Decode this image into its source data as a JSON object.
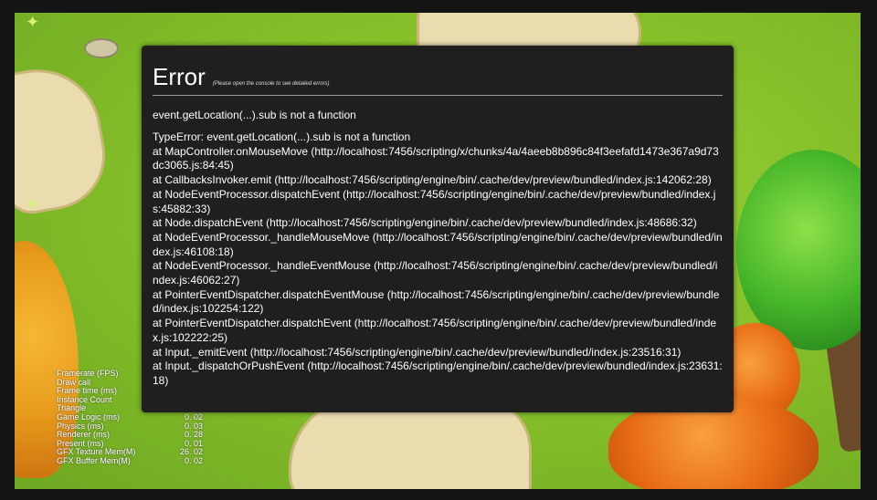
{
  "error": {
    "title": "Error",
    "hint": "(Please open the console to see detailed errors)",
    "message": "event.getLocation(...).sub is not a function",
    "stack": [
      "TypeError: event.getLocation(...).sub is not a function",
      "at MapController.onMouseMove (http://localhost:7456/scripting/x/chunks/4a/4aeeb8b896c84f3eefafd1473e367a9d73dc3065.js:84:45)",
      "at CallbacksInvoker.emit (http://localhost:7456/scripting/engine/bin/.cache/dev/preview/bundled/index.js:142062:28)",
      "at NodeEventProcessor.dispatchEvent (http://localhost:7456/scripting/engine/bin/.cache/dev/preview/bundled/index.js:45882:33)",
      "at Node.dispatchEvent (http://localhost:7456/scripting/engine/bin/.cache/dev/preview/bundled/index.js:48686:32)",
      "at NodeEventProcessor._handleMouseMove (http://localhost:7456/scripting/engine/bin/.cache/dev/preview/bundled/index.js:46108:18)",
      "at NodeEventProcessor._handleEventMouse (http://localhost:7456/scripting/engine/bin/.cache/dev/preview/bundled/index.js:46062:27)",
      "at PointerEventDispatcher.dispatchEventMouse (http://localhost:7456/scripting/engine/bin/.cache/dev/preview/bundled/index.js:102254:122)",
      "at PointerEventDispatcher.dispatchEvent (http://localhost:7456/scripting/engine/bin/.cache/dev/preview/bundled/index.js:102222:25)",
      "at Input._emitEvent (http://localhost:7456/scripting/engine/bin/.cache/dev/preview/bundled/index.js:23516:31)",
      "at Input._dispatchOrPushEvent (http://localhost:7456/scripting/engine/bin/.cache/dev/preview/bundled/index.js:23631:18)"
    ]
  },
  "stats": [
    {
      "label": "Framerate (FPS)",
      "value": ""
    },
    {
      "label": "Draw call",
      "value": ""
    },
    {
      "label": "Frame time (ms)",
      "value": ""
    },
    {
      "label": "Instance Count",
      "value": ""
    },
    {
      "label": "Triangle",
      "value": ""
    },
    {
      "label": "Game Logic (ms)",
      "value": "0. 02"
    },
    {
      "label": "Physics (ms)",
      "value": "0. 03"
    },
    {
      "label": "Renderer (ms)",
      "value": "0. 28"
    },
    {
      "label": "Present (ms)",
      "value": "0. 01"
    },
    {
      "label": "GFX Texture Mem(M)",
      "value": "26. 02"
    },
    {
      "label": "GFX Buffer Mem(M)",
      "value": "0. 02"
    }
  ],
  "colors": {
    "panel_bg": "#1f1f1f",
    "grass": "#86c12a",
    "frame": "#141414"
  }
}
